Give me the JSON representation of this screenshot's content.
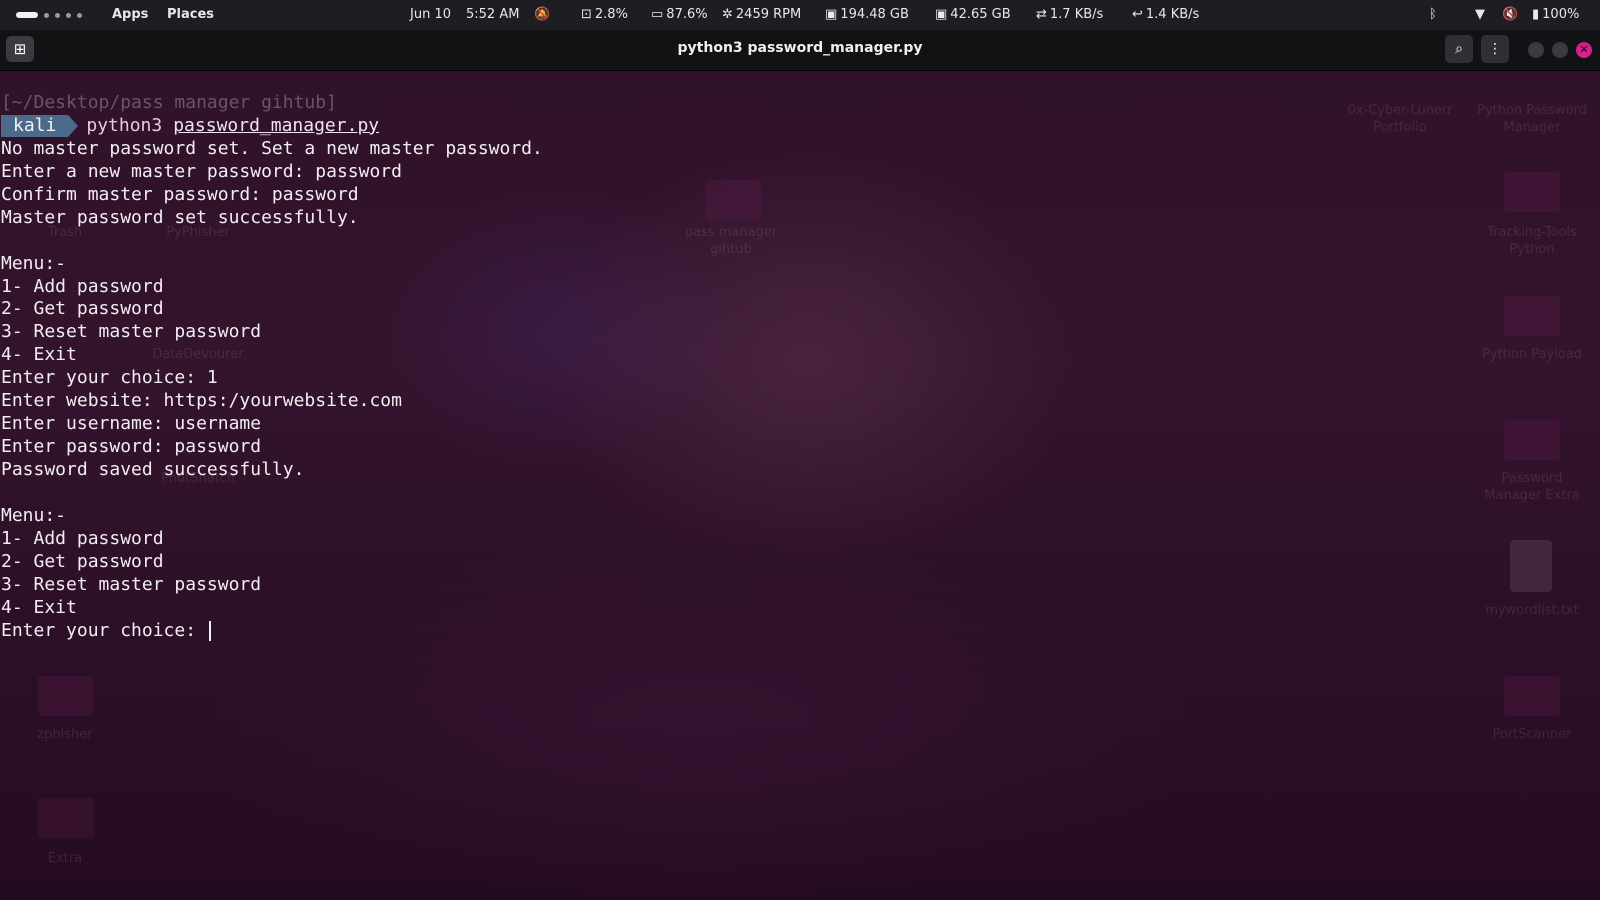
{
  "topbar": {
    "apps": "Apps",
    "places": "Places",
    "date": "Jun 10",
    "time": "5:52 AM",
    "cpu": "2.8%",
    "memory": "87.6%",
    "fan": "2459 RPM",
    "disk1": "194.48 GB",
    "disk2": "42.65 GB",
    "net_up": "1.7 KB/s",
    "net_down": "1.4 KB/s",
    "battery": "100%"
  },
  "titlebar": {
    "title": "python3 password_manager.py"
  },
  "terminal": {
    "path": "[~/Desktop/pass manager gihtub]",
    "user": "kali",
    "command": "python3",
    "command_arg": "password_manager.py",
    "lines": [
      "No master password set. Set a new master password.",
      "Enter a new master password: password",
      "Confirm master password: password",
      "Master password set successfully.",
      "",
      "Menu:-",
      "1- Add password",
      "2- Get password",
      "3- Reset master password",
      "4- Exit",
      "Enter your choice: 1",
      "Enter website: https:/yourwebsite.com",
      "Enter username: username",
      "Enter password: password",
      "Password saved successfully.",
      "",
      "Menu:-",
      "1- Add password",
      "2- Get password",
      "3- Reset master password",
      "4- Exit"
    ],
    "current_prompt": "Enter your choice: "
  },
  "desktop_icons": {
    "trash": "Trash",
    "pyphisher": "PyPhisher",
    "pass_manager_line1": "pass manager",
    "pass_manager_line2": "gihtub",
    "portfolio_line1": "0x-Cyber-Lunerr",
    "portfolio_line2": "Portfolio",
    "python_pm_line1": "Python Password",
    "python_pm_line2": "Manager",
    "tracking_line1": "Tracking-Tools",
    "tracking_line2": "Python",
    "datadevourer": "DataDevourer",
    "python_payload": "Python Payload",
    "photosnatch": "PhotSnatch",
    "pm_extra_line1": "Password",
    "pm_extra_line2": "Manager Extra",
    "wordlist": "mywordlist.txt",
    "zphisher": "zphisher",
    "portscanner": "PortScanner",
    "extra": "Extra"
  },
  "colors": {
    "accent_close": "#d61f8c",
    "prompt_user_bg": "#4c6a8a"
  }
}
